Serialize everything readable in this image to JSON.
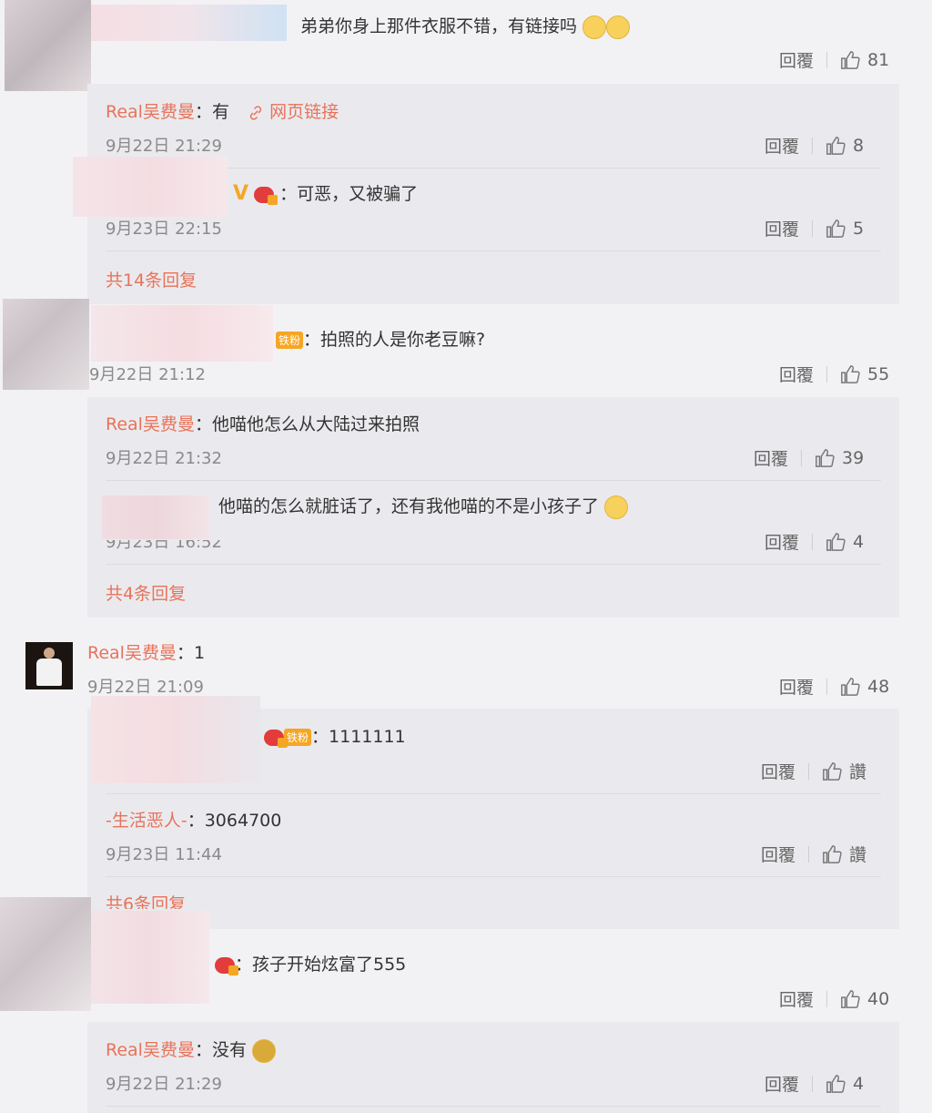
{
  "labels": {
    "reply": "回覆",
    "like": "讚"
  },
  "colors": {
    "name": "#e8735a",
    "background": "#f2f2f5",
    "thread_background": "#eaeaee"
  },
  "comments": [
    {
      "text": "弟弟你身上那件衣服不错，有链接吗",
      "likes": "81",
      "replies": [
        {
          "author": "Real吴费曼",
          "sep": "：",
          "text": "有",
          "link_icon": "link-icon",
          "link_text": "网页链接",
          "time": "9月22日 21:29",
          "likes": "8"
        },
        {
          "text": "：可恶，又被骗了",
          "time": "9月23日 22:15",
          "likes": "5"
        }
      ],
      "more": "共14条回复"
    },
    {
      "text": "：拍照的人是你老豆嘛?",
      "badge": "铁粉",
      "time": "9月22日 21:12",
      "likes": "55",
      "replies": [
        {
          "author": "Real吴费曼",
          "text": "：他喵他怎么从大陆过来拍照",
          "time": "9月22日 21:32",
          "likes": "39"
        },
        {
          "text": "他喵的怎么就脏话了，还有我他喵的不是小孩子了",
          "time": "9月23日 16:52",
          "likes": "4"
        }
      ],
      "more": "共4条回复"
    },
    {
      "author": "Real吴费曼",
      "text": "：1",
      "time": "9月22日 21:09",
      "likes": "48",
      "replies": [
        {
          "badge": "铁粉",
          "text": "：1111111"
        },
        {
          "author": "-生活恶人-",
          "text": "：3064700",
          "time": "9月23日 11:44"
        }
      ],
      "more": "共6条回复"
    },
    {
      "text": "：孩子开始炫富了555",
      "likes": "40",
      "replies": [
        {
          "author": "Real吴费曼",
          "text": "：没有",
          "time": "9月22日 21:29",
          "likes": "4"
        }
      ]
    }
  ]
}
